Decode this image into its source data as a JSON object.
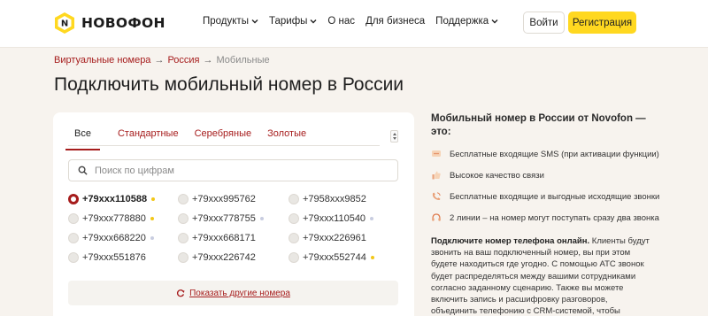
{
  "header": {
    "logo_text": "НОВОФОН",
    "nav": [
      {
        "label": "Продукты",
        "dropdown": true
      },
      {
        "label": "Тарифы",
        "dropdown": true
      },
      {
        "label": "О нас",
        "dropdown": false
      },
      {
        "label": "Для бизнеса",
        "dropdown": false
      },
      {
        "label": "Поддержка",
        "dropdown": true
      }
    ],
    "login_label": "Войти",
    "register_label": "Регистрация"
  },
  "breadcrumbs": {
    "items": [
      "Виртуальные номера",
      "Россия",
      "Мобильные"
    ],
    "separator": "→"
  },
  "page_title": "Подключить мобильный номер в России",
  "card": {
    "tabs": [
      "Все",
      "Стандартные",
      "Серебряные",
      "Золотые"
    ],
    "active_tab": "Все",
    "search_placeholder": "Поиск по цифрам",
    "search_value": "",
    "numbers": [
      {
        "number": "+79xxx110588",
        "dot": "gold",
        "selected": true
      },
      {
        "number": "+79xxx995762",
        "dot": "",
        "selected": false
      },
      {
        "number": "+7958xxx9852",
        "dot": "",
        "selected": false
      },
      {
        "number": "+79xxx778880",
        "dot": "gold",
        "selected": false
      },
      {
        "number": "+79xxx778755",
        "dot": "silver",
        "selected": false
      },
      {
        "number": "+79xxx110540",
        "dot": "silver",
        "selected": false
      },
      {
        "number": "+79xxx668220",
        "dot": "silver",
        "selected": false
      },
      {
        "number": "+79xxx668171",
        "dot": "",
        "selected": false
      },
      {
        "number": "+79xxx226961",
        "dot": "",
        "selected": false
      },
      {
        "number": "+79xxx551876",
        "dot": "",
        "selected": false
      },
      {
        "number": "+79xxx226742",
        "dot": "",
        "selected": false
      },
      {
        "number": "+79xxx552744",
        "dot": "gold",
        "selected": false
      }
    ],
    "more_label": "Показать другие номера"
  },
  "info": {
    "title": "Мобильный номер в России от Novofon — это:",
    "features": [
      {
        "icon": "sms-icon",
        "text": "Бесплатные входящие SMS (при активации функции)"
      },
      {
        "icon": "thumbs-up-icon",
        "text": "Высокое качество связи"
      },
      {
        "icon": "phone-calls-icon",
        "text": "Бесплатные входящие и выгодные исходящие звонки"
      },
      {
        "icon": "headset-icon",
        "text": "2 линии – на номер могут поступать сразу два звонка"
      }
    ],
    "desc_bold": "Подключите номер телефона онлайн.",
    "desc_text": " Клиенты будут звонить на ваш подключенный номер, вы при этом будете находиться где угодно. С помощью АТС звонок будет распределяться между вашими сотрудниками согласно заданному сценарию. Также вы можете включить запись и расшифровку разговоров, объединить телефонию с CRM-системой, чтобы хранить историю взаимоотношений с клиентами."
  },
  "colors": {
    "accent": "#a61c1c",
    "brand_yellow": "#ffd820",
    "page_bg": "#f7f3ee",
    "gold_dot": "#f2c718",
    "silver_dot": "#c8cde0"
  }
}
